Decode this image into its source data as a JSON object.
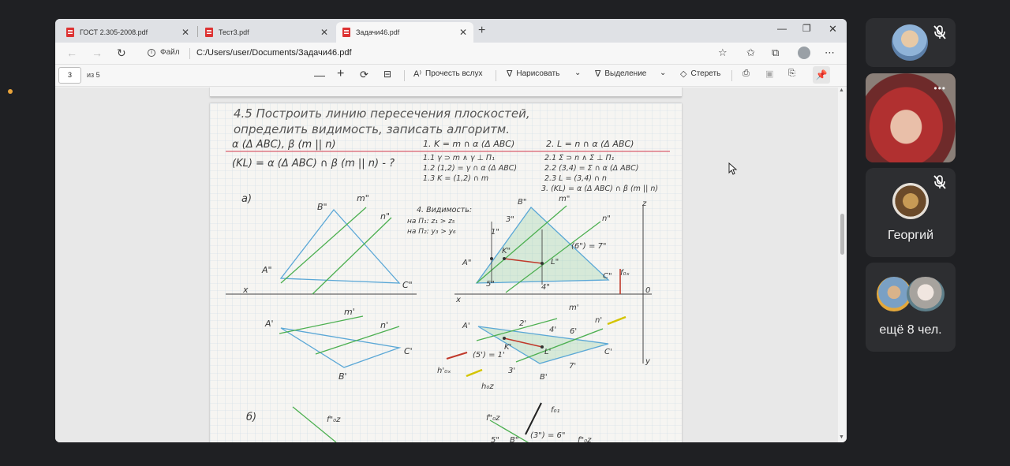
{
  "browser": {
    "tabs": [
      {
        "label": "ГОСТ 2.305-2008.pdf"
      },
      {
        "label": "Тест3.pdf"
      },
      {
        "label": "Задачи46.pdf",
        "active": true
      }
    ],
    "new_tab": "+",
    "address": {
      "scheme_label": "Файл",
      "url": "C:/Users/user/Documents/Задачи46.pdf"
    }
  },
  "pdf_toolbar": {
    "page_number": "3",
    "page_total": "из 5",
    "read_aloud": "Прочесть вслух",
    "draw": "Нарисовать",
    "highlight": "Выделение",
    "erase": "Стереть"
  },
  "document": {
    "task_heading_line1": "4.5  Построить линию пересечения плоскостей,",
    "task_heading_line2": "определить видимость, записать алгоритм.",
    "given": "α (Δ ABC), β (m || n)",
    "find": "(KL) = α (Δ ABC) ∩ β (m || n) - ?",
    "step1_title": "1. K = m ∩ α (Δ ABC)",
    "step1_lines": [
      "1.1  γ ⊃ m ∧ γ ⊥ Π₁",
      "1.2 (1,2) = γ ∩ α (Δ ABC)",
      "1.3  K = (1,2) ∩ m"
    ],
    "step2_title": "2. L = n ∩ α (Δ ABC)",
    "step2_lines": [
      "2.1  Σ ⊃ n ∧ Σ ⊥ Π₁",
      "2.2 (3,4) = Σ ∩ α (Δ ABC)",
      "2.3  L = (3,4) ∩ n",
      "3. (KL) = α (Δ ABC) ∩ β (m || n)"
    ],
    "visibility_title": "4. Видимость:",
    "visibility_lines": [
      "на Π₁: z₁ > z₅",
      "на Π₂: y₃ > y₆"
    ],
    "label_a": "а)",
    "label_b": "б)",
    "labels": {
      "B2": "B\"",
      "m2": "m\"",
      "n2": "n\"",
      "A2": "A\"",
      "C2": "C\"",
      "A1": "A'",
      "m1": "m'",
      "n1": "n'",
      "C1": "C'",
      "B1": "B'",
      "x": "x",
      "z": "z",
      "y": "y",
      "o": "0",
      "K2": "K\"",
      "L2": "L\"",
      "K1": "K'",
      "L1": "L'",
      "p3": "3\"",
      "p1": "1\"",
      "p5": "5\"",
      "p4": "4\"",
      "p6": "(6\") = 7\"",
      "p2": "2'",
      "p4b": "4'",
      "p6b": "6'",
      "p51": "(5') = 1'",
      "p3b": "3'",
      "p7": "7'",
      "f0x": "f₀ₓ",
      "h0x": "h₀ₓ",
      "hox": "h'₀ₓ",
      "hoz": "h₀z",
      "f01": "f₀₁",
      "f1": "f\"₀z",
      "b5": "5\"",
      "b6": "(3\") = 6\"",
      "B2b": "B\""
    }
  },
  "participants": [
    {
      "id": "p1",
      "mic_muted": true
    },
    {
      "id": "p2",
      "video": true
    },
    {
      "id": "p3",
      "name": "Георгий",
      "mic_muted": true
    },
    {
      "id": "p4",
      "name": "ещё 8 чел."
    }
  ],
  "colors": {
    "grid": "#c9dbe6",
    "blue_line": "#5aa7d6",
    "green_line": "#4caf50",
    "red_line": "#c0392b",
    "pencil": "#333333",
    "accent_dot": "#e8a33a"
  }
}
